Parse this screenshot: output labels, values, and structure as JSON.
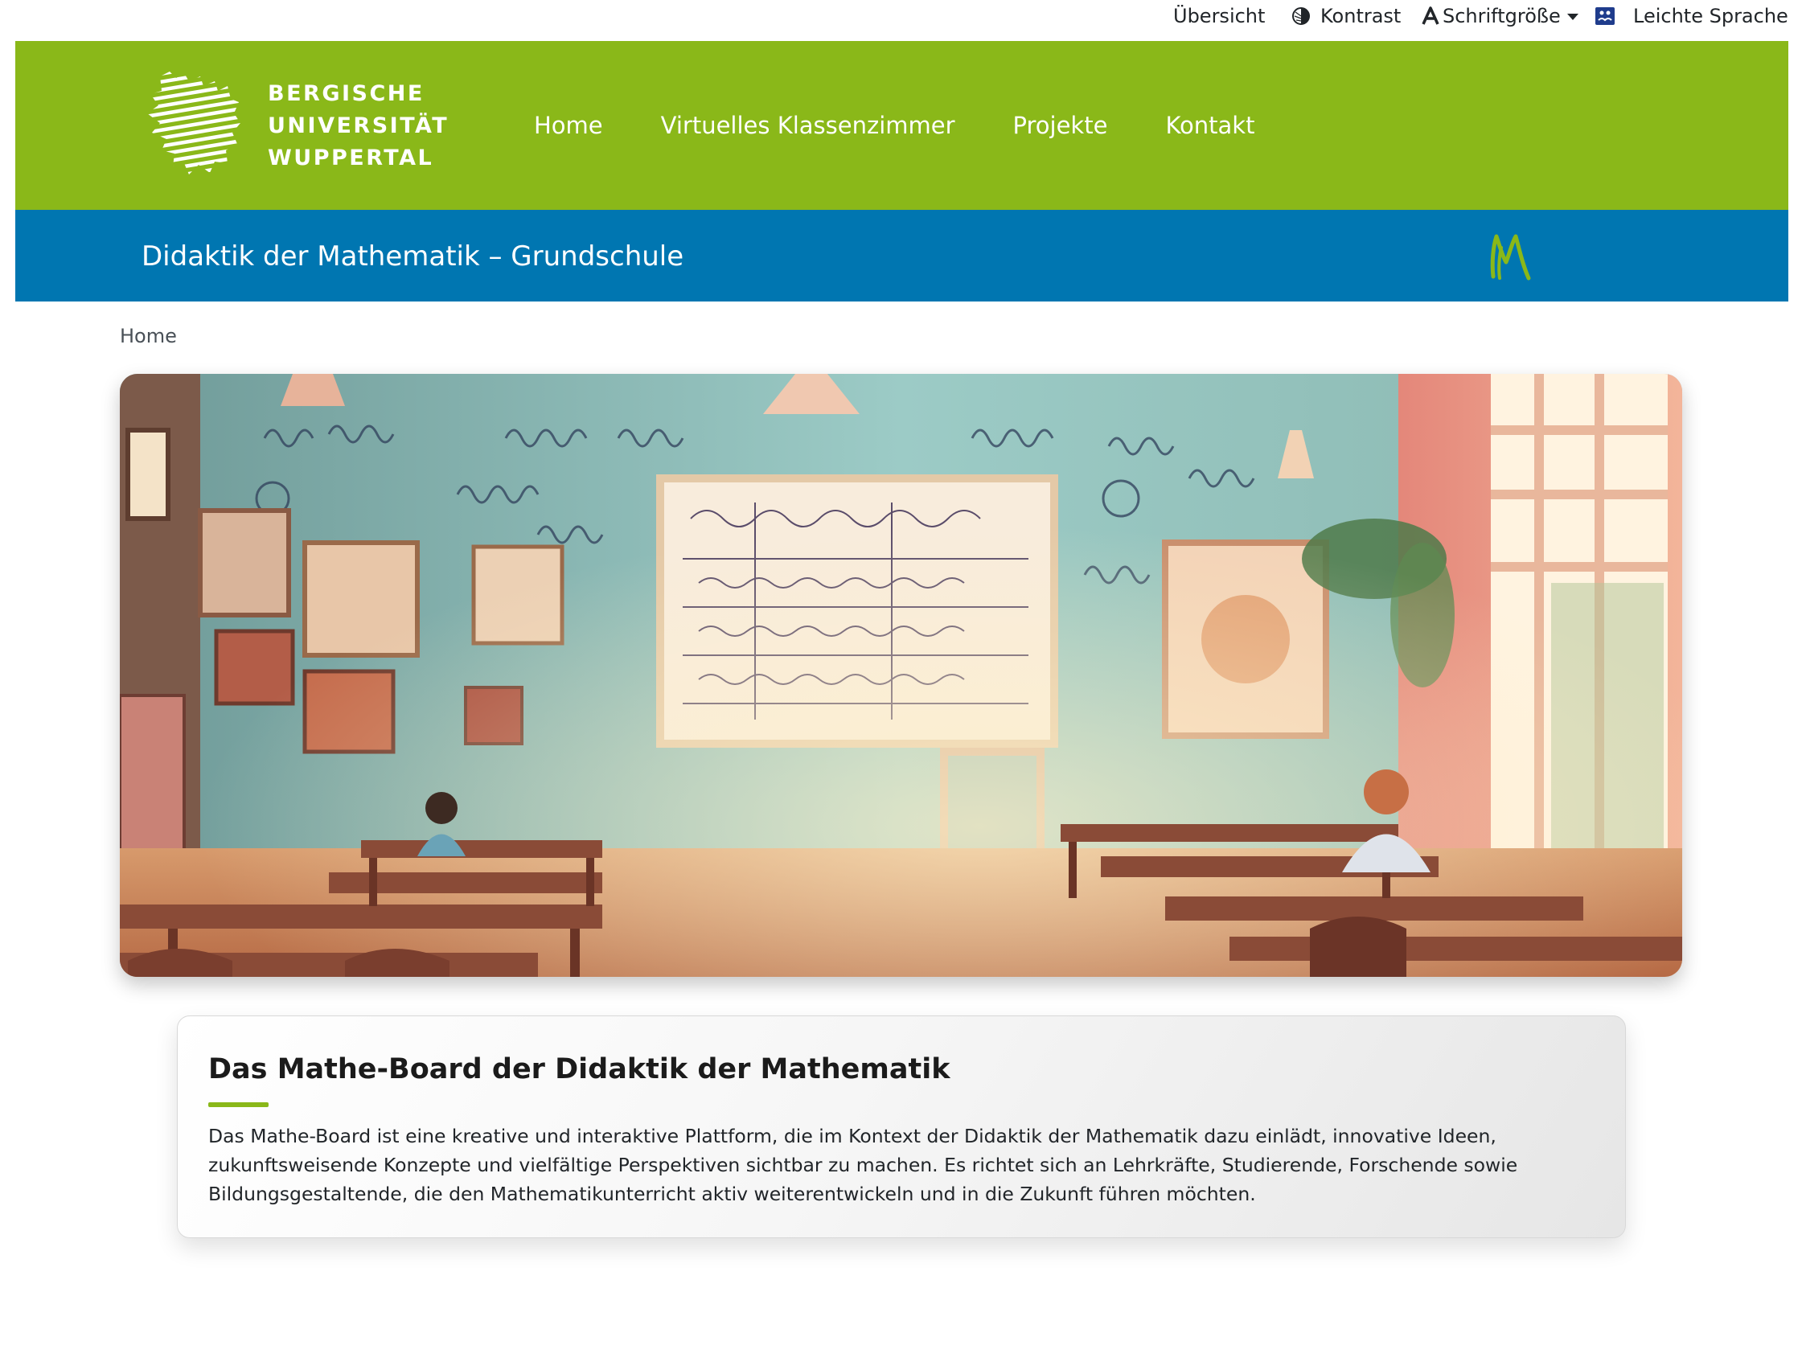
{
  "utility_bar": {
    "overview": "Übersicht",
    "contrast": "Kontrast",
    "font_size": "Schriftgröße",
    "easy_language": "Leichte Sprache"
  },
  "header": {
    "logo_lines": [
      "BERGISCHE",
      "UNIVERSITÄT",
      "WUPPERTAL"
    ],
    "nav": [
      "Home",
      "Virtuelles Klassenzimmer",
      "Projekte",
      "Kontakt"
    ],
    "colors": {
      "green": "#8ab819",
      "blue": "#0076b1"
    }
  },
  "subheader": {
    "title": "Didaktik der Mathematik – Grundschule"
  },
  "breadcrumb": {
    "current": "Home"
  },
  "card": {
    "title": "Das Mathe-Board der Didaktik der Mathematik",
    "text": "Das Mathe-Board ist eine kreative und interaktive Plattform, die im Kontext der Didaktik der Mathematik dazu einlädt, innovative Ideen, zukunftsweisende Konzepte und vielfältige Perspektiven sichtbar zu machen. Es richtet sich an Lehrkräfte, Studierende, Forschende sowie Bildungsgestaltende, die den Mathematikunterricht aktiv weiterentwickeln und in die Zukunft führen möchten."
  }
}
